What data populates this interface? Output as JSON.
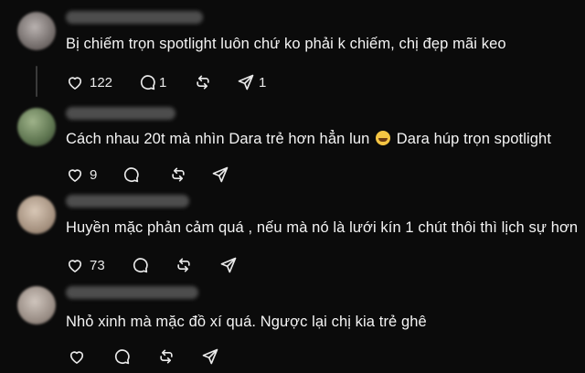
{
  "comments": [
    {
      "text": "Bị chiếm trọn spotlight luôn chứ ko phải k chiếm, chị đẹp mãi keo",
      "likes": "122",
      "replies": "1",
      "shares": "1"
    },
    {
      "text_before": "Cách nhau 20t mà nhìn Dara trẻ hơn hẳn lun ",
      "emoji": "laughing-with-tears-emoji",
      "text_after": " Dara húp trọn spotlight",
      "likes": "9"
    },
    {
      "text": "Huyền mặc phản cảm quá , nếu mà nó là lưới kín 1 chút thôi thì lịch sự hơn",
      "likes": "73"
    },
    {
      "text": "Nhỏ xinh mà mặc đồ xí quá. Ngược lại chị kia trẻ ghê"
    }
  ],
  "icons": {
    "like": "heart-icon",
    "reply": "comment-bubble-icon",
    "repost": "repost-arrows-icon",
    "share": "send-paper-plane-icon"
  },
  "colors": {
    "background": "#0b0b0b",
    "text": "#f3f3f3",
    "icon": "#e9e9e9"
  }
}
